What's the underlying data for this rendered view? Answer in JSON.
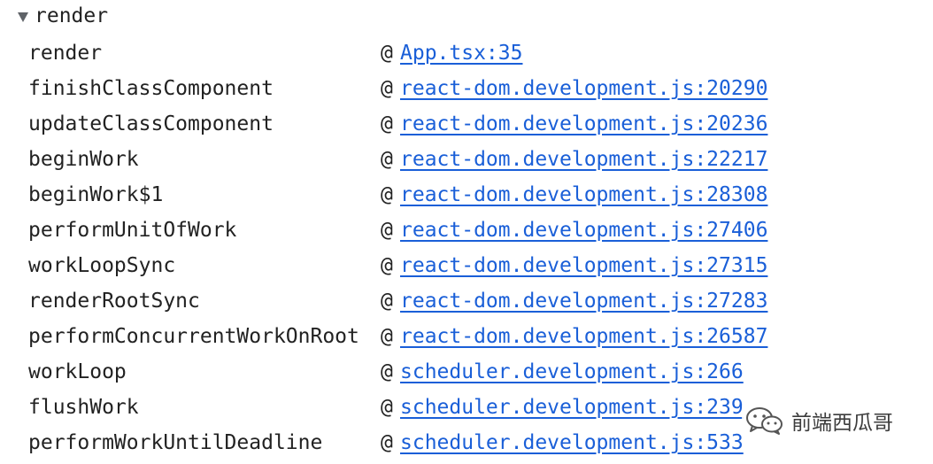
{
  "group": {
    "label": "render",
    "expanded": true,
    "toggle_icon": "triangle-down-icon"
  },
  "frames": [
    {
      "function": "render",
      "source": "App.tsx:35"
    },
    {
      "function": "finishClassComponent",
      "source": "react-dom.development.js:20290"
    },
    {
      "function": "updateClassComponent",
      "source": "react-dom.development.js:20236"
    },
    {
      "function": "beginWork",
      "source": "react-dom.development.js:22217"
    },
    {
      "function": "beginWork$1",
      "source": "react-dom.development.js:28308"
    },
    {
      "function": "performUnitOfWork",
      "source": "react-dom.development.js:27406"
    },
    {
      "function": "workLoopSync",
      "source": "react-dom.development.js:27315"
    },
    {
      "function": "renderRootSync",
      "source": "react-dom.development.js:27283"
    },
    {
      "function": "performConcurrentWorkOnRoot",
      "source": "react-dom.development.js:26587"
    },
    {
      "function": "workLoop",
      "source": "scheduler.development.js:266"
    },
    {
      "function": "flushWork",
      "source": "scheduler.development.js:239"
    },
    {
      "function": "performWorkUntilDeadline",
      "source": "scheduler.development.js:533"
    }
  ],
  "at_symbol": "@",
  "watermark": {
    "text": "前端西瓜哥",
    "icon": "wechat-logo-icon"
  },
  "colors": {
    "link": "#1a5fd8",
    "text": "#222222",
    "triangle": "#5f6368"
  }
}
